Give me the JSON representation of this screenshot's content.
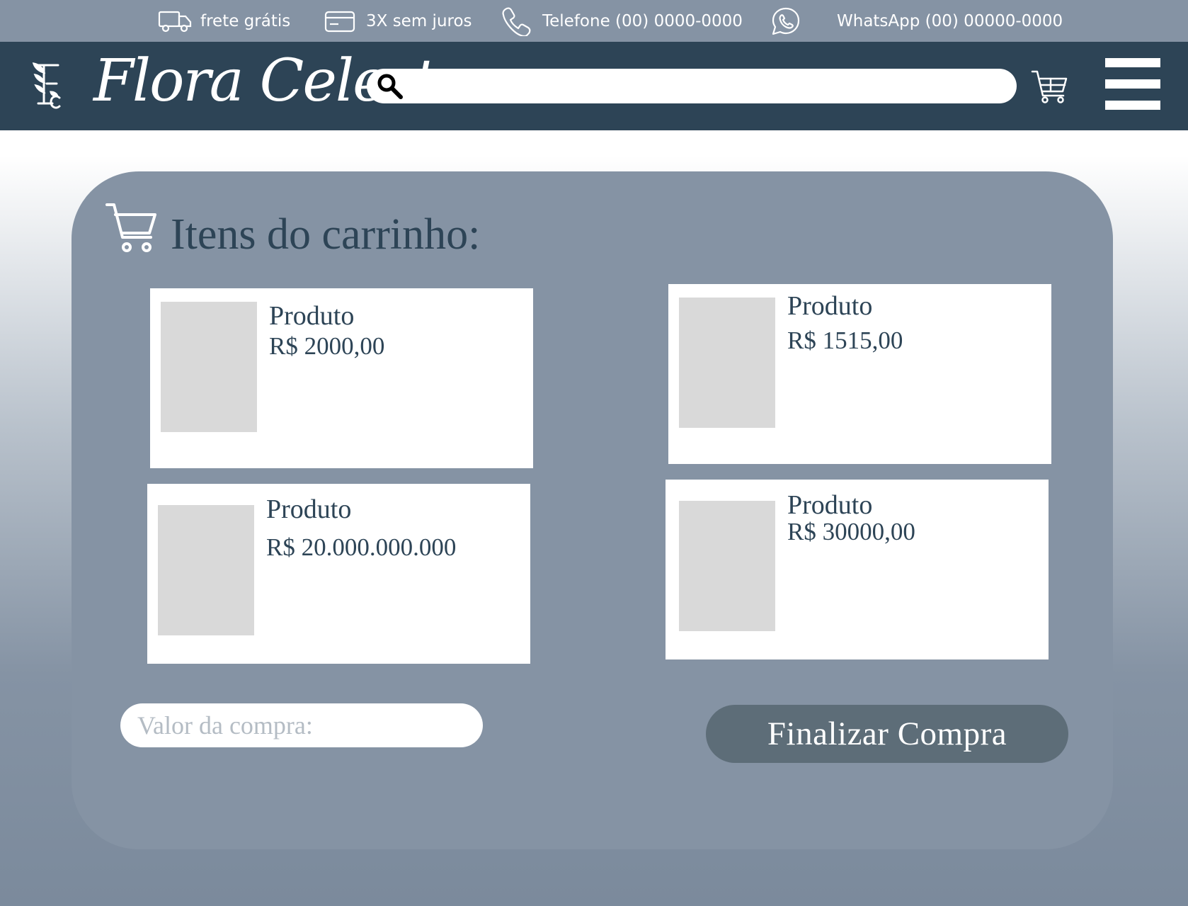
{
  "topbar": {
    "shipping": "frete grátis",
    "installments": "3X sem juros",
    "phone": "Telefone (00) 0000-0000",
    "whatsapp": "WhatsApp (00) 00000-0000"
  },
  "header": {
    "brand": "Flora Celeste",
    "search_placeholder": ""
  },
  "cart": {
    "title": "Itens do carrinho:",
    "items": [
      {
        "name": "Produto",
        "price": "R$ 2000,00"
      },
      {
        "name": "Produto",
        "price": "R$ 1515,00"
      },
      {
        "name": "Produto",
        "price": "R$ 20.000.000.000"
      },
      {
        "name": "Produto",
        "price": "R$ 30000,00"
      }
    ],
    "total_placeholder": "Valor da compra:",
    "checkout_label": "Finalizar Compra"
  },
  "colors": {
    "topbar": "#8593a4",
    "header": "#2d4456",
    "panel": "#8593a4",
    "checkout": "#5d6d78",
    "text_dark": "#2d4456"
  },
  "icons": {
    "shipping": "truck-icon",
    "installments": "credit-card-icon",
    "phone": "phone-icon",
    "whatsapp": "whatsapp-icon",
    "logo": "logo-monogram-icon",
    "search": "search-icon",
    "cart": "cart-icon",
    "menu": "hamburger-menu-icon"
  }
}
